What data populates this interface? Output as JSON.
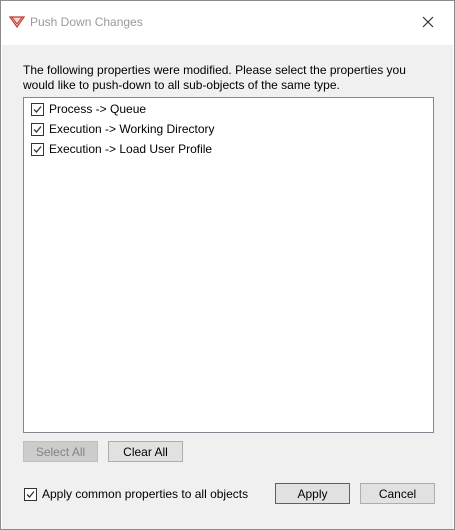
{
  "window": {
    "title": "Push Down Changes",
    "close_icon": "close-icon",
    "app_icon": "app-logo-icon"
  },
  "dialog": {
    "message": "The following properties were modified. Please select the properties you would like to push-down to all sub-objects of the same type.",
    "properties": [
      {
        "label": "Process -> Queue",
        "checked": true
      },
      {
        "label": "Execution -> Working Directory",
        "checked": true
      },
      {
        "label": "Execution -> Load User Profile",
        "checked": true
      }
    ],
    "select_all_label": "Select All",
    "select_all_enabled": false,
    "clear_all_label": "Clear All",
    "apply_common_label": "Apply common properties to all objects",
    "apply_common_checked": true,
    "apply_label": "Apply",
    "cancel_label": "Cancel"
  },
  "colors": {
    "accent": "#0078d7",
    "dialog_background": "#f0f0f0",
    "title_text": "#9a9a9a"
  }
}
